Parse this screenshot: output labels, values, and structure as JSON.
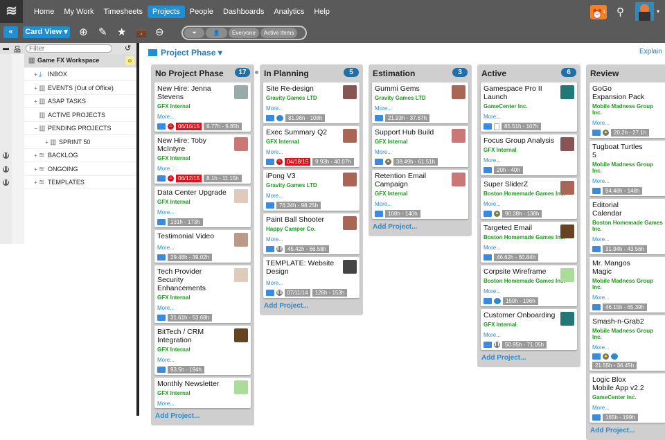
{
  "app": {
    "logo_glyph": "≋"
  },
  "nav": {
    "items": [
      "Home",
      "My Work",
      "Timesheets",
      "Projects",
      "People",
      "Dashboards",
      "Analytics",
      "Help"
    ],
    "active": "Projects"
  },
  "topbar": {
    "alarm_count": "1",
    "search_icon": "search-icon",
    "avatar_caret": "▾"
  },
  "toolbar": {
    "collapse_label": "«",
    "view_label": "Card View ▾",
    "icons": [
      "add-icon",
      "pencil-icon",
      "star-icon",
      "briefcase-icon",
      "minus-circle-icon"
    ],
    "pills": [
      "Everyone",
      "Active Items"
    ]
  },
  "sidebar": {
    "filter_placeholder": "Filter",
    "workspace": "Game FX Workspace",
    "items": [
      {
        "label": "INBOX",
        "exp": "+",
        "paused": false
      },
      {
        "label": "EVENTS (Out of Office)",
        "exp": "+",
        "paused": false
      },
      {
        "label": "ASAP TASKS",
        "exp": "+",
        "paused": false
      },
      {
        "label": "ACTIVE PROJECTS",
        "exp": "",
        "paused": false
      },
      {
        "label": "PENDING PROJECTS",
        "exp": "−",
        "paused": false
      },
      {
        "label": "SPRINT 50",
        "exp": "+",
        "paused": false,
        "indent": true
      },
      {
        "label": "BACKLOG",
        "exp": "+",
        "paused": true
      },
      {
        "label": "ONGOING",
        "exp": "+",
        "paused": true
      },
      {
        "label": "TEMPLATES",
        "exp": "+",
        "paused": true
      }
    ]
  },
  "board": {
    "title": "Project Phase ▾",
    "explain": "Explain",
    "add_label": "Add Project...",
    "more_label": "More...",
    "columns": [
      {
        "name": "No Project Phase",
        "count": "17",
        "cards": [
          {
            "title": "New Hire: Jenna Stevens",
            "client": "GFX Internal",
            "icons": [
              "fire"
            ],
            "date": "06/16/15",
            "hours": "6.77h - 9.85h",
            "avatar": "#9aa"
          },
          {
            "title": "New Hire: Toby McIntyre",
            "client": "GFX Internal",
            "icons": [
              "fire"
            ],
            "date": "06/12/15",
            "hours": "8.1h - 11.15h",
            "avatar": "#c77"
          },
          {
            "title": "Data Center Upgrade",
            "client": "GFX Internal",
            "icons": [],
            "hours": "131h - 173h",
            "avatar": "#dcb"
          },
          {
            "title": "Testimonial Video",
            "client": "",
            "icons": [],
            "hours": "29.48h - 39.02h",
            "avatar": "#b98"
          },
          {
            "title": "Tech Provider Security Enhancements",
            "client": "GFX Internal",
            "icons": [],
            "hours": "31.61h - 53.69h",
            "avatar": "#dcb"
          },
          {
            "title": "BitTech / CRM Integration",
            "client": "GFX Internal",
            "icons": [],
            "hours": "93.5h - 194h",
            "avatar": "#642"
          },
          {
            "title": "Monthly Newsletter",
            "client": "GFX Internal",
            "icons": [],
            "hours": "",
            "avatar": "#ad9"
          }
        ]
      },
      {
        "name": "In Planning",
        "count": "5",
        "cards": [
          {
            "title": "Site Re-design",
            "client": "Gravity Games LTD",
            "icons": [
              "chat-doc"
            ],
            "hours": "81.96h - 108h",
            "avatar": "#855"
          },
          {
            "title": "Exec Summary Q2",
            "client": "GFX Internal",
            "icons": [
              "fire"
            ],
            "date": "04/18/15",
            "hours": "9.93h - 40.07h",
            "avatar": "#a65"
          },
          {
            "title": "iPong V3",
            "client": "Gravity Games LTD",
            "icons": [],
            "hours": "76.34h - 98.25h",
            "avatar": "#a65"
          },
          {
            "title": "Paint Ball Shooter",
            "client": "Happy Camper Co.",
            "icons": [
              "pause"
            ],
            "hours": "45.42h - 66.58h",
            "avatar": "#a65"
          },
          {
            "title": "TEMPLATE: Website Design",
            "client": "",
            "icons": [
              "pause"
            ],
            "date": "07/11/14",
            "date_gray": true,
            "hours": "126h - 153h",
            "avatar": "#444"
          }
        ]
      },
      {
        "name": "Estimation",
        "count": "3",
        "cards": [
          {
            "title": "Gummi Gems",
            "client": "Gravity Games LTD",
            "icons": [],
            "hours": "21.93h - 37.67h",
            "avatar": "#a65"
          },
          {
            "title": "Support Hub Build",
            "client": "GFX Internal",
            "icons": [
              "warn"
            ],
            "hours": "38.49h - 61.51h",
            "avatar": "#c77"
          },
          {
            "title": "Retention Email Campaign",
            "client": "GFX Internal",
            "icons": [],
            "hours": "108h - 140h",
            "avatar": "#c77"
          }
        ]
      },
      {
        "name": "Active",
        "count": "6",
        "cards": [
          {
            "title": "Gamespace Pro II Launch",
            "client": "GameCenter Inc.",
            "icons": [
              "doc"
            ],
            "hours": "85.51h - 107h",
            "avatar": "#277"
          },
          {
            "title": "Focus Group Analysis",
            "client": "GFX Internal",
            "icons": [],
            "hours": "20h - 40h",
            "avatar": "#855"
          },
          {
            "title": "Super SliderZ",
            "client": "Boston Homemade Games Inc.",
            "icons": [
              "warn"
            ],
            "hours": "90.38h - 138h",
            "avatar": "#a65"
          },
          {
            "title": "Targeted Email",
            "client": "Boston Homemade Games Inc.",
            "icons": [],
            "hours": "46.62h - 60.84h",
            "avatar": "#642"
          },
          {
            "title": "Corpsite Wireframe",
            "client": "Boston Homemade Games Inc.",
            "icons": [
              "chat-doc"
            ],
            "hours": "150h - 196h",
            "avatar": "#ad9"
          },
          {
            "title": "Customer Onboarding",
            "client": "GFX Internal",
            "icons": [
              "pause"
            ],
            "hours": "50.95h - 71.05h",
            "avatar": "#277"
          }
        ]
      },
      {
        "name": "Review",
        "count": "",
        "cards": [
          {
            "title": "GoGo Expansion Pack",
            "client": "Mobile Madness Group Inc.",
            "icons": [
              "warn"
            ],
            "hours": "20.2h - 27.1h"
          },
          {
            "title": "Tugboat Turtles 5",
            "client": "Mobile Madness Group Inc.",
            "icons": [],
            "hours": "94.48h - 148h"
          },
          {
            "title": "Editorial Calendar",
            "client": "Boston Homemade Games Inc.",
            "icons": [],
            "hours": "31.94h - 43.56h"
          },
          {
            "title": "Mr. Mangos Magic",
            "client": "Mobile Madness Group Inc.",
            "icons": [],
            "hours": "46.15h - 65.39h"
          },
          {
            "title": "Smash-n-Grab2",
            "client": "Mobile Madness Group Inc.",
            "icons": [
              "warn",
              "chat"
            ],
            "hours": "21.55h - 36.45h"
          },
          {
            "title": "Logic Blox Mobile App v2.2",
            "client": "GameCenter Inc.",
            "icons": [],
            "hours": "165h - 199h"
          }
        ]
      }
    ]
  }
}
